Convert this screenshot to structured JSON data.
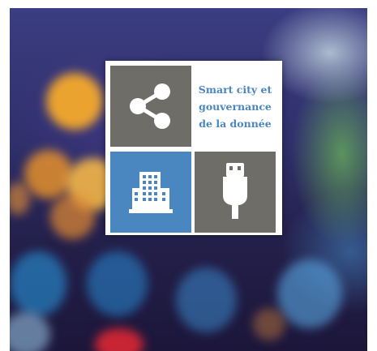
{
  "panel": {
    "tagline": "Smart city et\ngouvernance\nde la donnée"
  },
  "tiles": [
    {
      "icon": "share-icon",
      "color": "#6e6d68"
    },
    {
      "icon": "text"
    },
    {
      "icon": "building-icon",
      "color": "#4a86c0"
    },
    {
      "icon": "usb-plug-icon",
      "color": "#6e6d68"
    }
  ],
  "colors": {
    "accent": "#4a86c0",
    "tile_gray": "#6e6d68",
    "icon": "#ffffff"
  }
}
